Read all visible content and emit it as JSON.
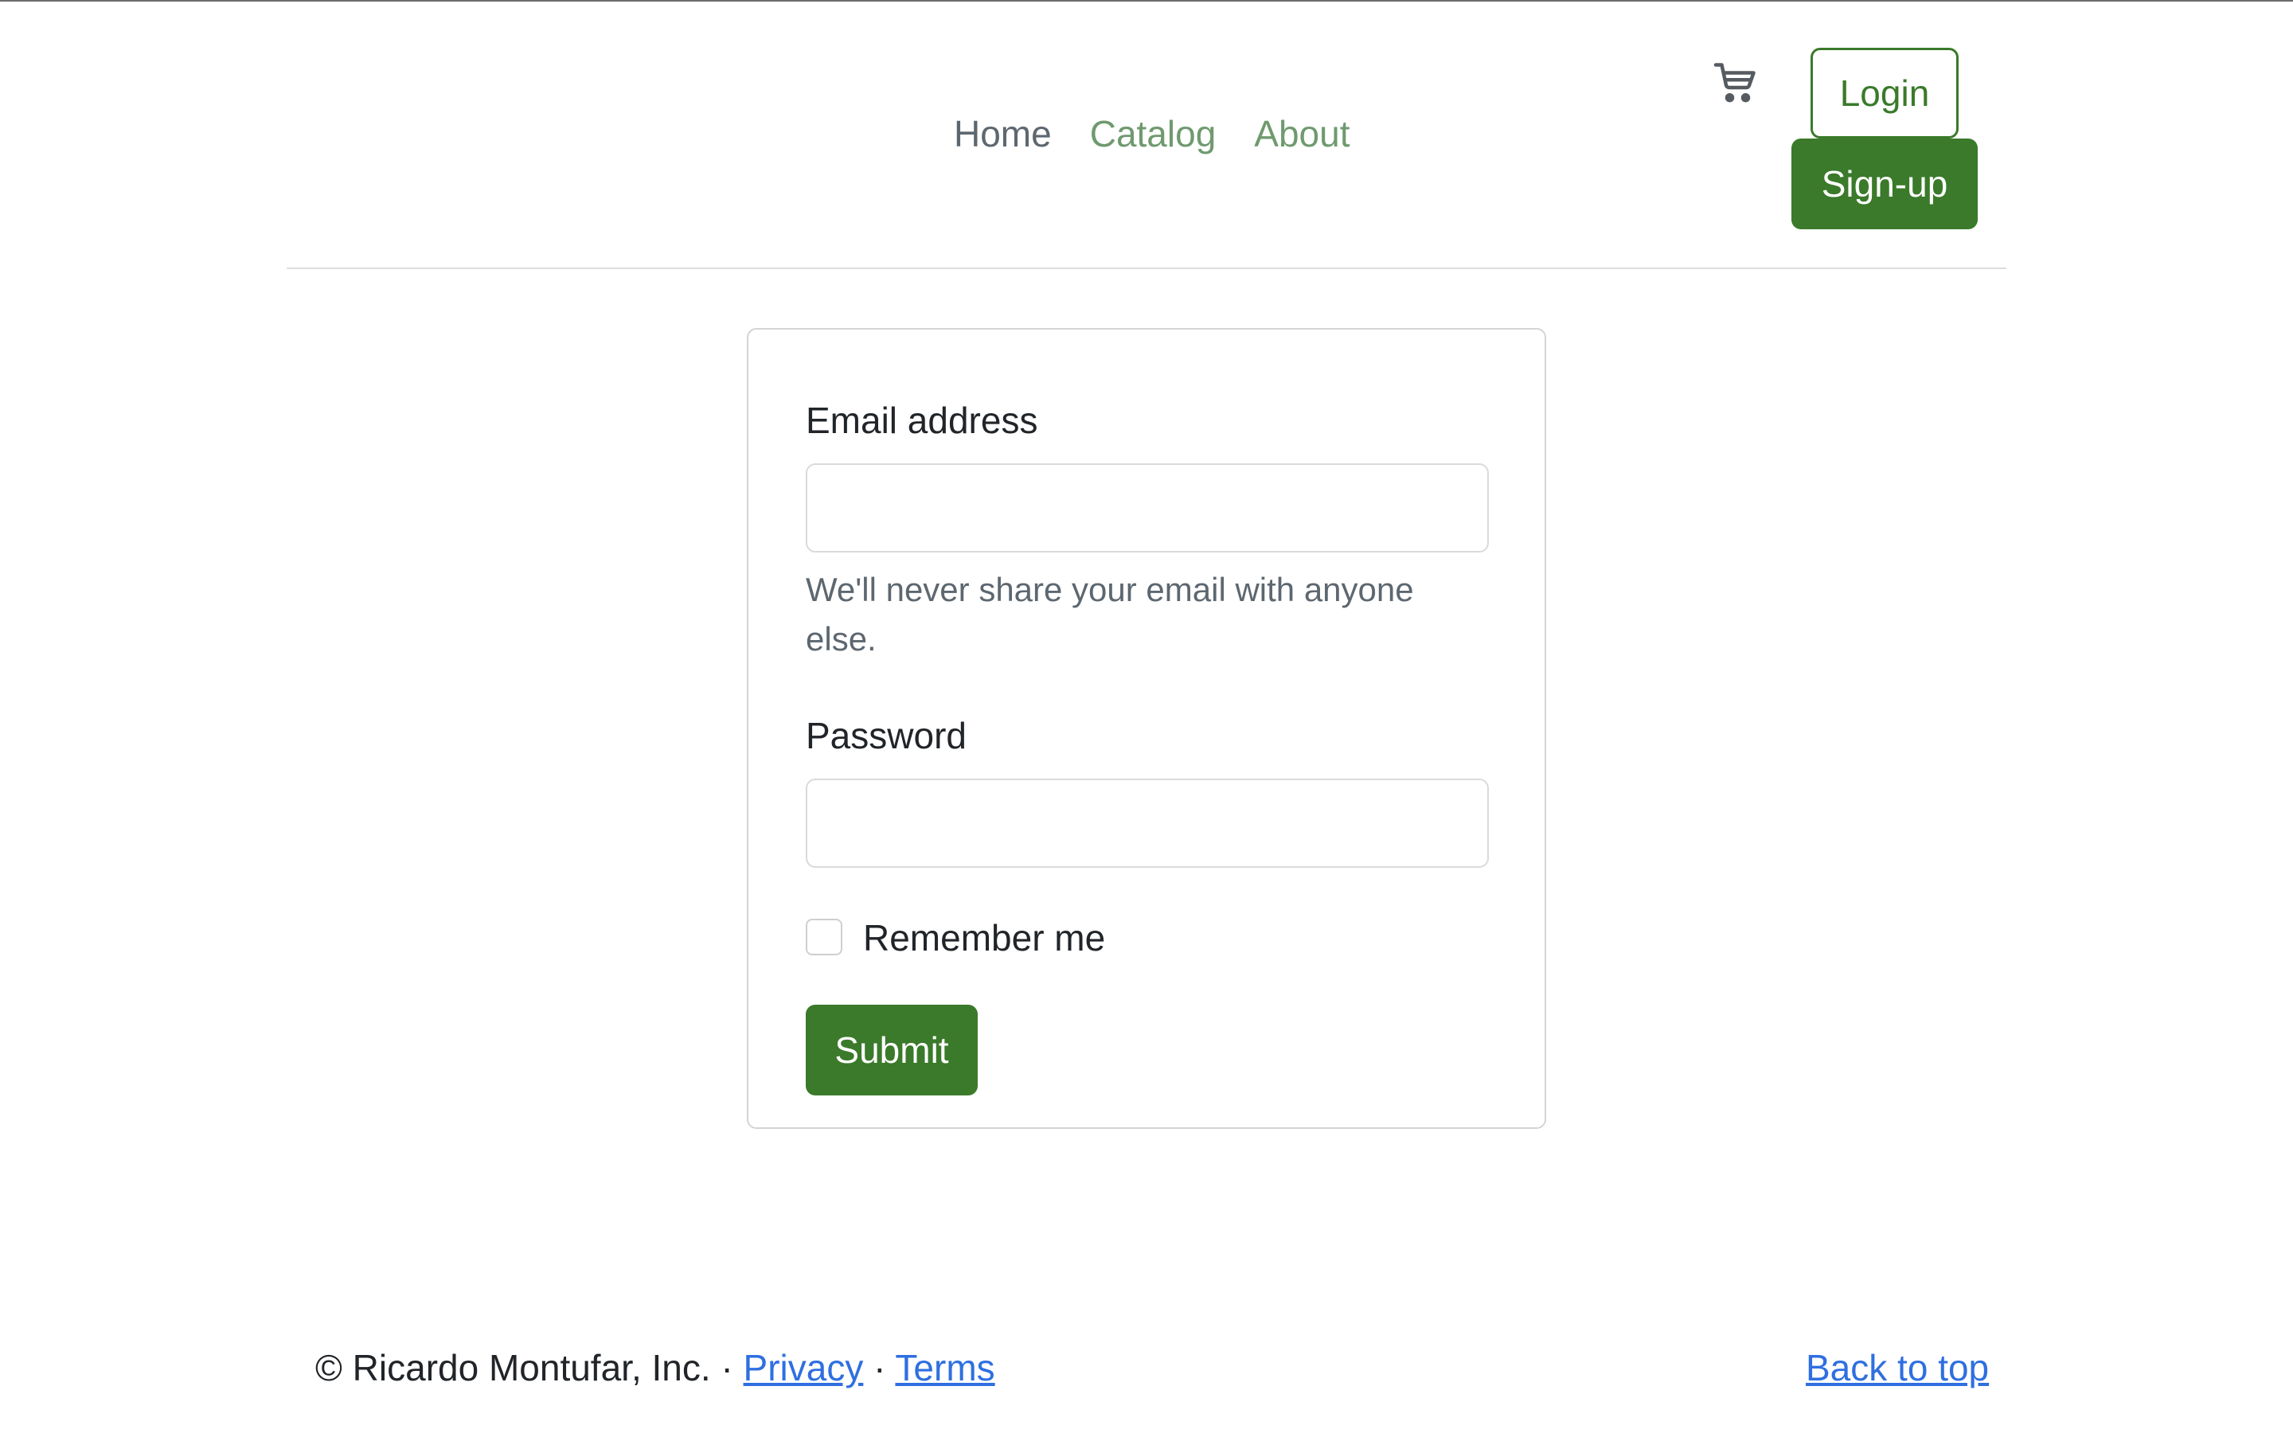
{
  "header": {
    "nav": [
      {
        "label": "Home"
      },
      {
        "label": "Catalog"
      },
      {
        "label": "About"
      }
    ],
    "cart_icon": "cart-icon",
    "login_label": "Login",
    "signup_label": "Sign-up"
  },
  "form": {
    "email_label": "Email address",
    "email_value": "",
    "email_help": "We'll never share your email with anyone else.",
    "password_label": "Password",
    "password_value": "",
    "remember_label": "Remember me",
    "remember_checked": false,
    "submit_label": "Submit"
  },
  "footer": {
    "copyright": "© Ricardo Montufar, Inc.",
    "separator": "·",
    "privacy_label": "Privacy",
    "terms_label": "Terms",
    "back_to_top_label": "Back to top"
  },
  "colors": {
    "brand_green": "#3a7a2a",
    "nav_muted_green": "#6f9a6f",
    "link_blue": "#2f6fe0"
  }
}
